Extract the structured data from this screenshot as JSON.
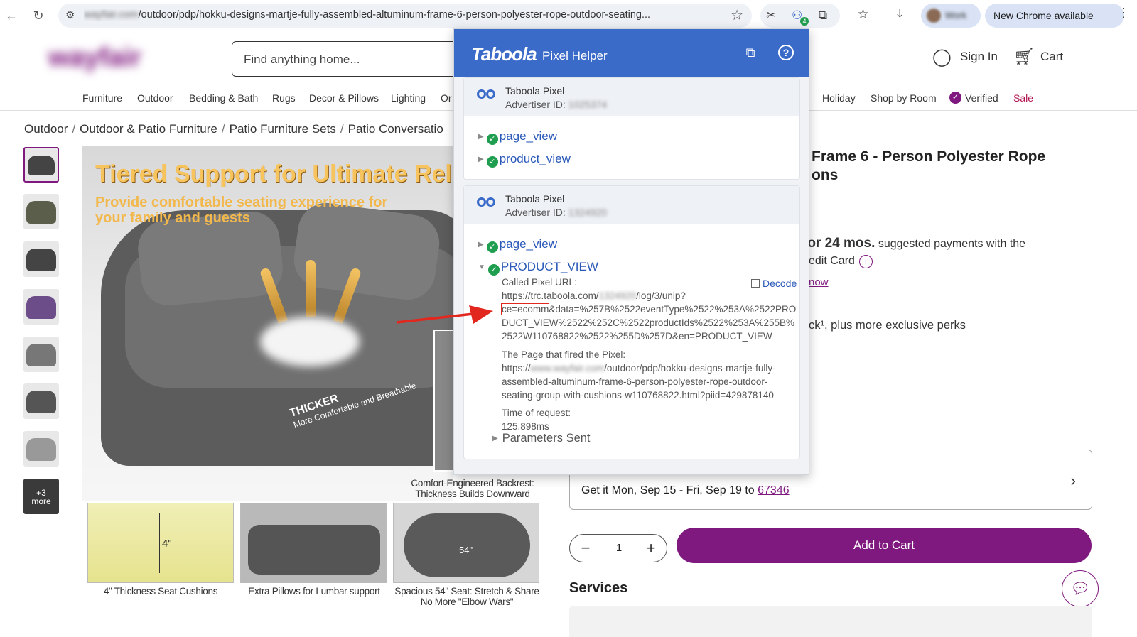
{
  "browser": {
    "url_host": "wayfair.com",
    "url_path": "/outdoor/pdp/hokku-designs-martje-fully-assembled-altuminum-frame-6-person-polyester-rope-outdoor-seating...",
    "ext_badge": "4",
    "profile_name": "Work",
    "new_chrome_label": "New Chrome available"
  },
  "header": {
    "logo": "wayfair",
    "search_placeholder": "Find anything home...",
    "sign_in": "Sign In",
    "cart": "Cart"
  },
  "categories": [
    "Furniture",
    "Outdoor",
    "Bedding & Bath",
    "Rugs",
    "Decor & Pillows",
    "Lighting",
    "Or",
    "Holiday",
    "Shop by Room",
    "Verified",
    "Sale"
  ],
  "breadcrumb": [
    "Outdoor",
    "Outdoor & Patio Furniture",
    "Patio Furniture Sets",
    "Patio Conversatio"
  ],
  "thumbnails": {
    "more_count": "+3",
    "more_label": "more"
  },
  "hero": {
    "title": "Tiered Support for Ultimate Rel",
    "subtitle": "Provide comfortable seating experience for your family and guests",
    "thicker": "THICKER",
    "thicker_sub": "More Comfortable and Breathable",
    "backrest_caption": "Comfort-Engineered Backrest: Thickness Builds Downward"
  },
  "tiles": [
    {
      "label": "4\"",
      "caption": "4\" Thickness Seat Cushions"
    },
    {
      "label": "",
      "caption": "Extra Pillows for Lumbar support"
    },
    {
      "label": "54\"",
      "caption": "Spacious 54\" Seat: Stretch & Share No More \"Elbow Wars\""
    }
  ],
  "product": {
    "title_line1": "Frame 6 - Person Polyester Rope",
    "title_line2": "ons",
    "finance_bold": "for 24 mos.",
    "finance_rest": " suggested payments with the",
    "finance_line2": "edit Card",
    "finance_link": "now",
    "perks": "ck¹, plus more exclusive perks",
    "delivery_prefix": "Get it Mon, Sep 15 - Fri, Sep 19 to ",
    "delivery_zip": "67346",
    "qty": "1",
    "add_to_cart": "Add to Cart",
    "services": "Services"
  },
  "popup": {
    "brand": "Taboola",
    "subtitle": "Pixel Helper",
    "pixels": [
      {
        "title": "Taboola Pixel",
        "adv_label": "Advertiser ID:",
        "adv_id": "1025374",
        "events": [
          "page_view",
          "product_view"
        ]
      },
      {
        "title": "Taboola Pixel",
        "adv_label": "Advertiser ID:",
        "adv_id": "1324920",
        "events": [
          "page_view",
          "PRODUCT_VIEW"
        ],
        "detail": {
          "called_label": "Called Pixel URL:",
          "url_line1_a": "https://trc.taboola.com/",
          "url_line1_blur": "1324920",
          "url_line1_b": "/log/3/unip?",
          "url_hl": "ce=ecomm",
          "url_line2_rest": "&data=%257B%2522eventType%2522%253A%2522PRO",
          "url_line3": "DUCT_VIEW%2522%252C%2522productIds%2522%253A%255B%",
          "url_line4": "2522W110768822%2522%255D%257D&en=PRODUCT_VIEW",
          "page_label": "The Page that fired the Pixel:",
          "page_a": "https://",
          "page_blur": "www.wayfair.com",
          "page_b": "/outdoor/pdp/hokku-designs-martje-fully-",
          "page_line2": "assembled-altuminum-frame-6-person-polyester-rope-outdoor-",
          "page_line3": "seating-group-with-cushions-w110768822.html?piid=429878140",
          "time_label": "Time of request:",
          "time_value": "125.898ms",
          "decode": "Decode",
          "params": "Parameters Sent"
        }
      }
    ]
  },
  "colors": {
    "taboola_blue": "#3b6bc9",
    "wayfair_purple": "#7f187f",
    "success_green": "#1e9e4e",
    "annotation_red": "#e2271f"
  }
}
